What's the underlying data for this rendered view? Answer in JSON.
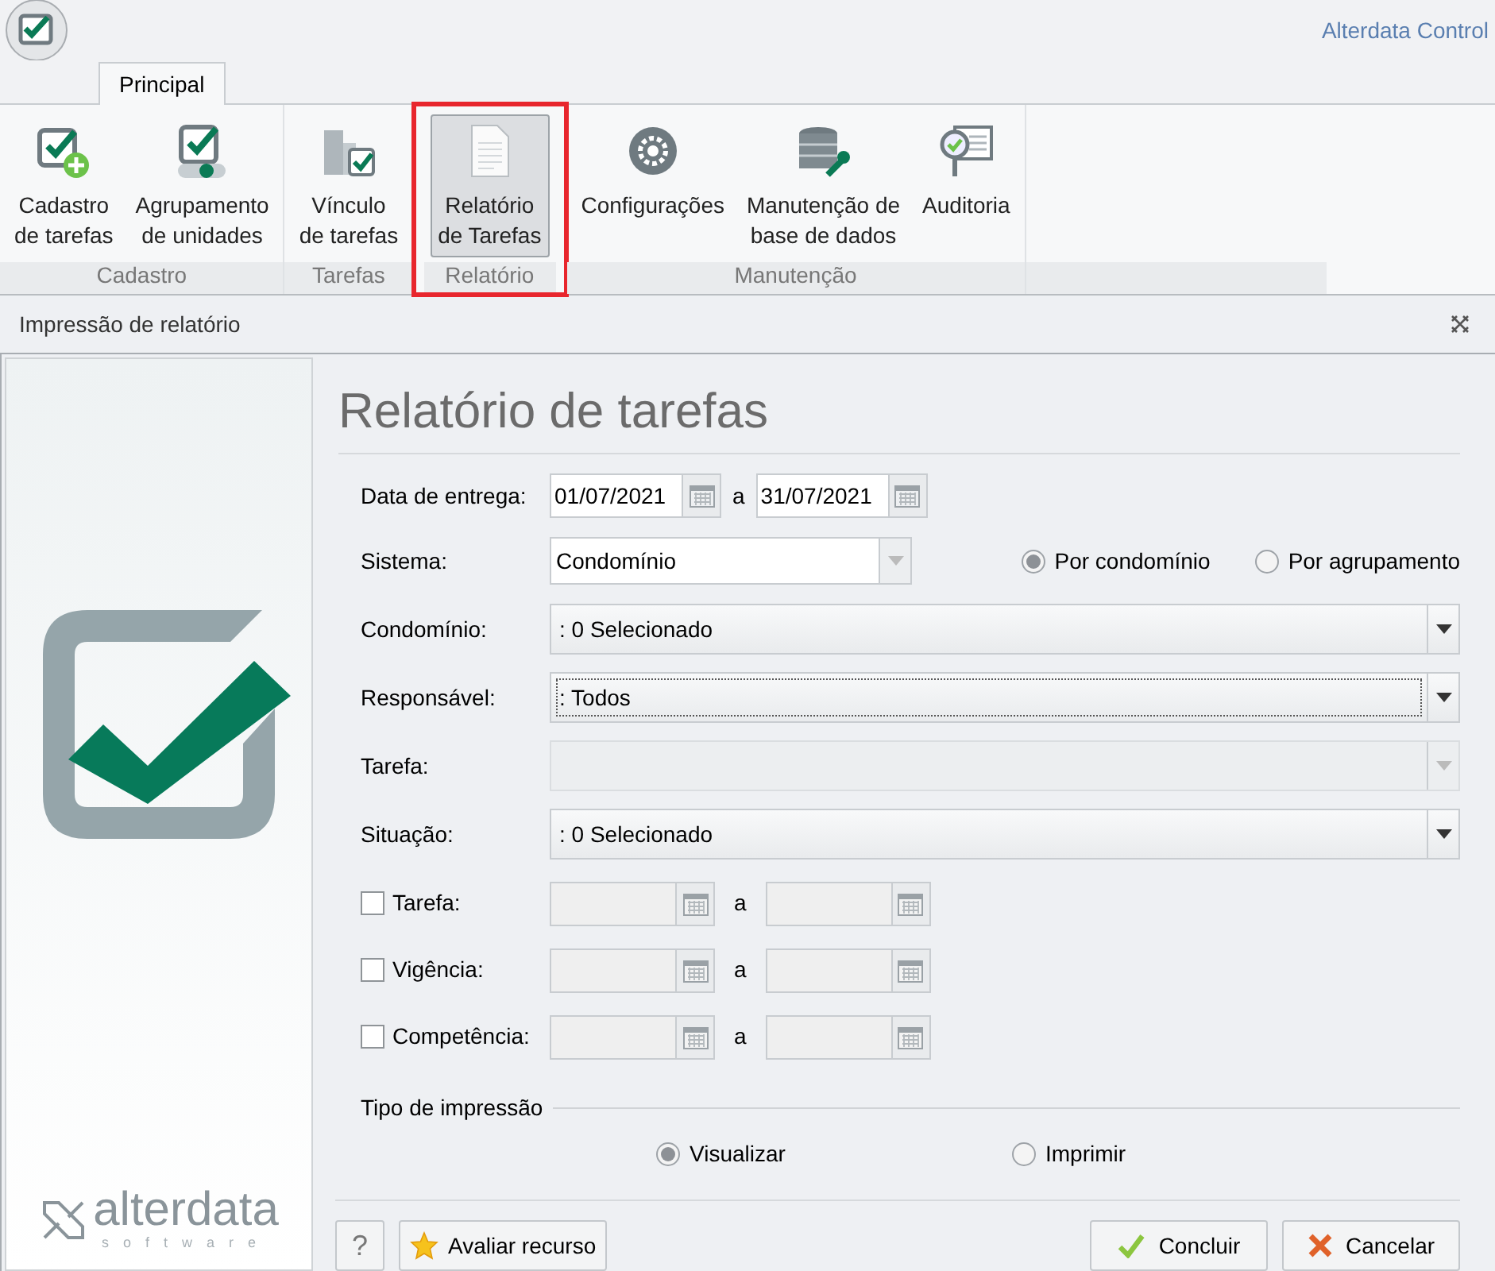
{
  "title_bar": {
    "app_title": "Alterdata Control"
  },
  "tabs": [
    {
      "label": "Principal",
      "selected": true
    }
  ],
  "ribbon": {
    "groups": [
      {
        "label": "Cadastro",
        "buttons": [
          {
            "label": "Cadastro\nde tarefas",
            "selected": false,
            "highlighted": false
          },
          {
            "label": "Agrupamento\nde unidades",
            "selected": false,
            "highlighted": false
          }
        ]
      },
      {
        "label": "Tarefas",
        "buttons": [
          {
            "label": "Vínculo\nde tarefas",
            "selected": false,
            "highlighted": false
          }
        ]
      },
      {
        "label": "Relatório",
        "buttons": [
          {
            "label": "Relatório\nde Tarefas",
            "selected": true,
            "highlighted": true
          }
        ]
      },
      {
        "label": "Manutenção",
        "buttons": [
          {
            "label": "Configurações",
            "selected": false,
            "highlighted": false
          },
          {
            "label": "Manutenção de\nbase de dados",
            "selected": false,
            "highlighted": false
          },
          {
            "label": "Auditoria",
            "selected": false,
            "highlighted": false
          }
        ]
      }
    ]
  },
  "dialog": {
    "title": "Impressão de relatório",
    "logo": {
      "name": "alterdata",
      "tagline": "software"
    },
    "heading": "Relatório de tarefas",
    "date_range": {
      "label": "Data de entrega:",
      "from": "01/07/2021",
      "separator": "a",
      "to": "31/07/2021"
    },
    "sistema": {
      "label": "Sistema:",
      "value": "Condomínio",
      "options": [
        {
          "label": "Por condomínio",
          "selected": true
        },
        {
          "label": "Por agrupamento",
          "selected": false
        }
      ]
    },
    "combos": [
      {
        "label": "Condomínio:",
        "value": ": 0 Selecionado",
        "disabled": false,
        "focused": false
      },
      {
        "label": "Responsável:",
        "value": ": Todos",
        "disabled": false,
        "focused": true
      },
      {
        "label": "Tarefa:",
        "disabled": true,
        "focused": false
      },
      {
        "label": "Situação:",
        "value": ": 0 Selecionado",
        "disabled": false,
        "focused": false
      }
    ],
    "optional_ranges": [
      {
        "label": "Tarefa:",
        "checked": false,
        "separator": "a"
      },
      {
        "label": "Vigência:",
        "checked": false,
        "separator": "a"
      },
      {
        "label": "Competência:",
        "checked": false,
        "separator": "a"
      }
    ],
    "print_type": {
      "label": "Tipo de impressão",
      "options": [
        {
          "label": "Visualizar",
          "selected": true
        },
        {
          "label": "Imprimir",
          "selected": false
        }
      ]
    },
    "buttons": {
      "help": "?",
      "rate": "Avaliar recurso",
      "ok": "Concluir",
      "cancel": "Cancelar"
    }
  }
}
